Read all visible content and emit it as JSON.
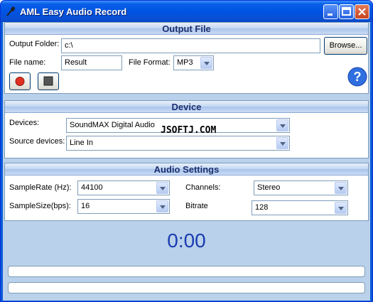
{
  "window": {
    "title": "AML Easy Audio Record"
  },
  "output_file": {
    "header": "Output File",
    "folder_label": "Output Folder:",
    "folder_value": "c:\\",
    "browse_label": "Browse...",
    "filename_label": "File name:",
    "filename_value": "Result",
    "format_label": "File Format:",
    "format_value": "MP3"
  },
  "device": {
    "header": "Device",
    "devices_label": "Devices:",
    "devices_value": "SoundMAX Digital Audio",
    "source_label": "Source devices:",
    "source_value": "Line In"
  },
  "audio": {
    "header": "Audio Settings",
    "samplerate_label": "SampleRate (Hz):",
    "samplerate_value": "44100",
    "channels_label": "Channels:",
    "channels_value": "Stereo",
    "samplesize_label": "SampleSize(bps):",
    "samplesize_value": "16",
    "bitrate_label": "Bitrate",
    "bitrate_value": "128"
  },
  "status": {
    "time": "0:00",
    "progress1": 0,
    "progress2": 0
  },
  "watermark": "JSOFTJ.COM",
  "colors": {
    "accent": "#0054e3",
    "time_text": "#1a3cb0",
    "record_red": "#e03020"
  }
}
